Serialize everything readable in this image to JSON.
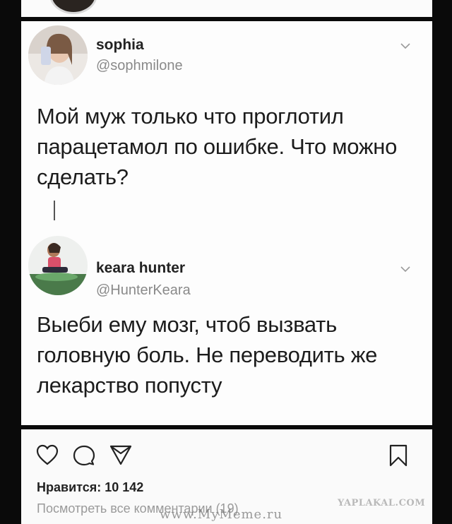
{
  "tweets": [
    {
      "name": "sophia",
      "handle": "@sophmilone",
      "text": "Мой муж только что проглотил парацетамол по ошибке. Что можно сделать?"
    },
    {
      "name": "keara hunter",
      "handle": "@HunterKeara",
      "text": "Выеби ему мозг, чтоб вызвать головную боль. Не переводить же лекарство попусту"
    }
  ],
  "instagram": {
    "likes_text": "Нравится: 10 142",
    "view_comments_text": "Посмотреть все комментарии (19)"
  },
  "watermarks": {
    "center": "www.MyMeme.ru",
    "corner": "YAPLAKAL.COM"
  },
  "icons": {
    "like": "heart-icon",
    "comment": "comment-bubble-icon",
    "share": "direct-send-icon",
    "save": "bookmark-icon",
    "menu": "chevron-down-icon"
  }
}
